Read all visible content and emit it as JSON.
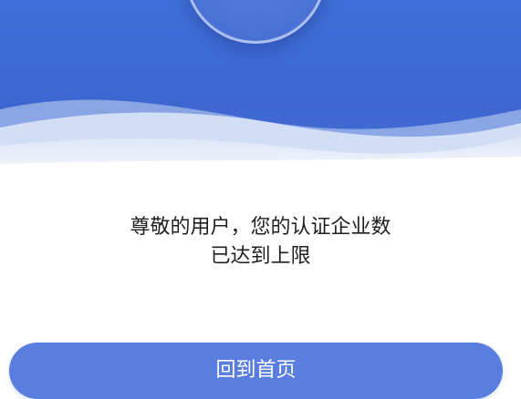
{
  "header": {
    "badge_icon": "info-dot-icon"
  },
  "message": {
    "line1": "尊敬的用户，您的认证企业数",
    "line2": "已达到上限"
  },
  "actions": {
    "home_button_label": "回到首页"
  },
  "colors": {
    "header_blue": "#3f6fd8",
    "button_blue": "#5a7ee0",
    "text_dark": "#1f1f1f",
    "background": "#ffffff"
  }
}
